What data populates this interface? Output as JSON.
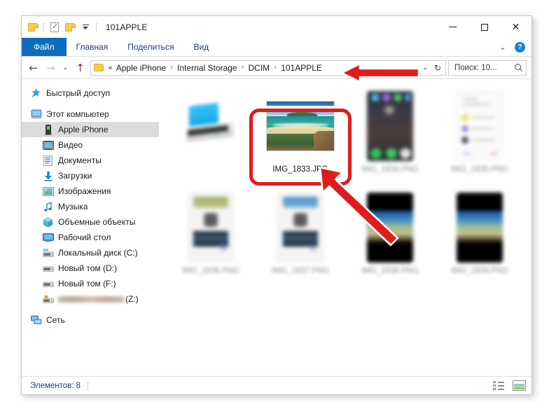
{
  "window": {
    "title": "101APPLE",
    "quick_access": [
      "folder-icon",
      "properties-icon",
      "new-folder-icon",
      "customize-dropdown"
    ],
    "controls": {
      "minimize": "—",
      "maximize": "□",
      "close": "✕"
    }
  },
  "ribbon": {
    "tabs": [
      {
        "label": "Файл",
        "active": true
      },
      {
        "label": "Главная",
        "active": false
      },
      {
        "label": "Поделиться",
        "active": false
      },
      {
        "label": "Вид",
        "active": false
      }
    ],
    "expand_icon": "chevron-down-icon",
    "help_icon": "help-icon",
    "help_glyph": "?",
    "active_tab_color": "#0f6cbd"
  },
  "navbar": {
    "back": "←",
    "forward": "→",
    "recent": "⌄",
    "up": "↑",
    "breadcrumb": {
      "overflow": "«",
      "items": [
        "Apple iPhone",
        "Internal Storage",
        "DCIM",
        "101APPLE"
      ],
      "separator": "›",
      "dropdown": "⌄",
      "refresh": "↻"
    },
    "search": {
      "placeholder": "Поиск: 10...",
      "icon": "search-icon"
    }
  },
  "sidebar": {
    "items": [
      {
        "label": "Быстрый доступ",
        "icon": "pin-star-icon",
        "indent": false,
        "selected": false,
        "gap_after": true
      },
      {
        "label": "Этот компьютер",
        "icon": "this-pc-icon",
        "indent": false,
        "selected": false
      },
      {
        "label": "Apple iPhone",
        "icon": "iphone-icon",
        "indent": true,
        "selected": true
      },
      {
        "label": "Видео",
        "icon": "video-icon",
        "indent": true,
        "selected": false
      },
      {
        "label": "Документы",
        "icon": "documents-icon",
        "indent": true,
        "selected": false
      },
      {
        "label": "Загрузки",
        "icon": "downloads-icon",
        "indent": true,
        "selected": false
      },
      {
        "label": "Изображения",
        "icon": "pictures-icon",
        "indent": true,
        "selected": false
      },
      {
        "label": "Музыка",
        "icon": "music-icon",
        "indent": true,
        "selected": false
      },
      {
        "label": "Объемные объекты",
        "icon": "3d-objects-icon",
        "indent": true,
        "selected": false
      },
      {
        "label": "Рабочий стол",
        "icon": "desktop-icon",
        "indent": true,
        "selected": false
      },
      {
        "label": "Локальный диск (C:)",
        "icon": "local-disk-icon",
        "indent": true,
        "selected": false
      },
      {
        "label": "Новый том (D:)",
        "icon": "drive-icon",
        "indent": true,
        "selected": false
      },
      {
        "label": "Новый том (F:)",
        "icon": "drive-icon",
        "indent": true,
        "selected": false
      },
      {
        "label": "(Z:)",
        "icon": "network-drive-icon",
        "indent": true,
        "selected": false,
        "redacted": true,
        "gap_after": true
      },
      {
        "label": "Сеть",
        "icon": "network-icon",
        "indent": false,
        "selected": false
      }
    ]
  },
  "files": [
    {
      "name": "",
      "thumb": "device",
      "blurred_name": true,
      "selected": false
    },
    {
      "name": "IMG_1833.JPG",
      "thumb": "beach-photo",
      "blurred_name": false,
      "selected": true
    },
    {
      "name": "IMG_1834.PNG",
      "thumb": "phone-home-screen",
      "blurred_name": true,
      "selected": false
    },
    {
      "name": "IMG_1835.PNG",
      "thumb": "phone-list-screen",
      "blurred_name": true,
      "selected": false
    },
    {
      "name": "IMG_1836.PNG",
      "thumb": "phone-share-screen",
      "blurred_name": true,
      "selected": false
    },
    {
      "name": "IMG_1837.PNG",
      "thumb": "phone-share-screen",
      "blurred_name": true,
      "selected": false
    },
    {
      "name": "IMG_1838.PNG",
      "thumb": "phone-dark-photo",
      "blurred_name": true,
      "selected": false
    },
    {
      "name": "IMG_1839.PNG",
      "thumb": "phone-dark-photo",
      "blurred_name": true,
      "selected": false
    }
  ],
  "statusbar": {
    "count_label": "Элементов: 8",
    "view_details": "details-view-icon",
    "view_large_icons": "large-icons-view-icon"
  },
  "annotations": {
    "highlight_color": "#e01b1b",
    "arrow_to_breadcrumb": "points at 101APPLE in address bar",
    "arrow_to_file": "points at IMG_1833.JPG thumbnail",
    "highlight_box": "surrounds IMG_1833.JPG"
  }
}
